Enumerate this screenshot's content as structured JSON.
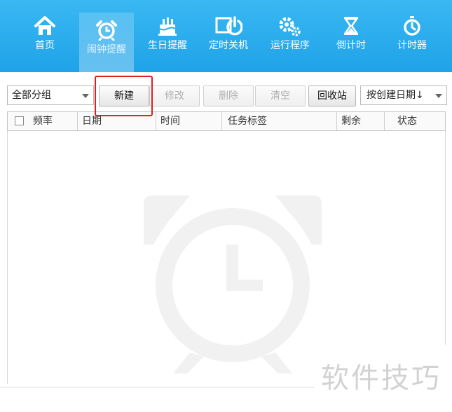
{
  "nav": {
    "items": [
      {
        "label": "首页",
        "icon": "home-icon"
      },
      {
        "label": "闹钟提醒",
        "icon": "alarm-clock-icon",
        "active": true
      },
      {
        "label": "生日提醒",
        "icon": "birthday-cake-icon"
      },
      {
        "label": "定时关机",
        "icon": "power-icon"
      },
      {
        "label": "运行程序",
        "icon": "gears-icon"
      },
      {
        "label": "倒计时",
        "icon": "hourglass-icon"
      },
      {
        "label": "计时器",
        "icon": "stopwatch-icon"
      }
    ]
  },
  "toolbar": {
    "group_select": "全部分组",
    "new_label": "新建",
    "edit_label": "修改",
    "delete_label": "删除",
    "clear_label": "清空",
    "recycle_label": "回收站",
    "sort_select": "按创建日期↓"
  },
  "table": {
    "columns": [
      "频率",
      "日期",
      "时间",
      "任务标签",
      "剩余",
      "状态"
    ],
    "rows": []
  },
  "watermark": {
    "text": "软件技巧"
  },
  "colors": {
    "header_bg": "#2aaeee",
    "highlight_box": "#e02020"
  }
}
